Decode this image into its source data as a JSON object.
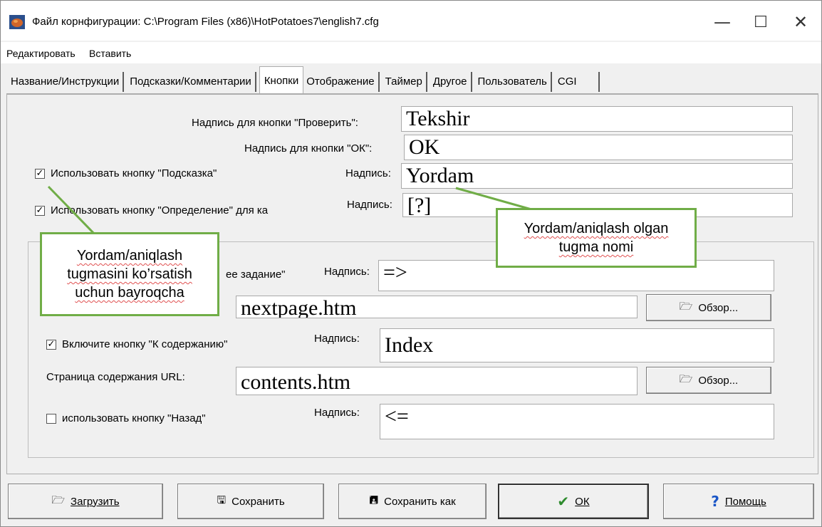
{
  "window": {
    "title": "Файл корнфигурации: C:\\Program Files (x86)\\HotPotatoes7\\english7.cfg",
    "minimize": "—",
    "maximize": "☐",
    "close": "✕"
  },
  "menu": {
    "edit": "Редактировать",
    "insert": "Вставить"
  },
  "tabs": [
    {
      "label": "Название/Инструкции"
    },
    {
      "label": "Подсказки/Комментарии"
    },
    {
      "label": "Кнопки"
    },
    {
      "label": "Отображение"
    },
    {
      "label": "Таймер"
    },
    {
      "label": "Другое"
    },
    {
      "label": "Пользователь"
    },
    {
      "label": "CGI"
    }
  ],
  "form": {
    "check_label": "Надпись для кнопки \"Проверить\":",
    "check_value": "Tekshir",
    "ok_label": "Надпись для кнопки \"ОК\":",
    "ok_value": "OK",
    "hint_checkbox": "Использовать кнопку \"Подсказка\"",
    "hint_checked": "✓",
    "hint_caption_label": "Надпись:",
    "hint_value": "Yordam",
    "def_checkbox": "Использовать кнопку \"Определение\" для ка",
    "def_checked": "✓",
    "def_caption_label": "Надпись:",
    "def_value": "[?]",
    "next_checkbox_partial": "ее задание\"",
    "next_caption_label": "Надпись:",
    "next_value": "=>",
    "next_url_value": "nextpage.htm",
    "browse_label": "Обзор...",
    "contents_checkbox": "Включите кнопку \"К содержанию\"",
    "contents_checked": "✓",
    "contents_caption_label": "Надпись:",
    "contents_value": "Index",
    "contents_url_label": "Страница содержания URL:",
    "contents_url_value": "contents.htm",
    "back_checkbox": "использовать кнопку \"Назад\"",
    "back_caption_label": "Надпись:",
    "back_value": "<="
  },
  "buttons": {
    "load": "Загрузить",
    "save": "Сохранить",
    "save_as": "Сохранить как",
    "ok": "ОК",
    "help": "Помощь"
  },
  "callouts": {
    "left_line1": "Yordam/aniqlash",
    "left_line2": "tugmasini ko’rsatish",
    "left_line3": "uchun bayroqcha",
    "right_line1": "Yordam/aniqlash olgan",
    "right_line2": "tugma nomi"
  },
  "colors": {
    "callout_border": "#70ad47",
    "spell_underline": "#e05050"
  }
}
